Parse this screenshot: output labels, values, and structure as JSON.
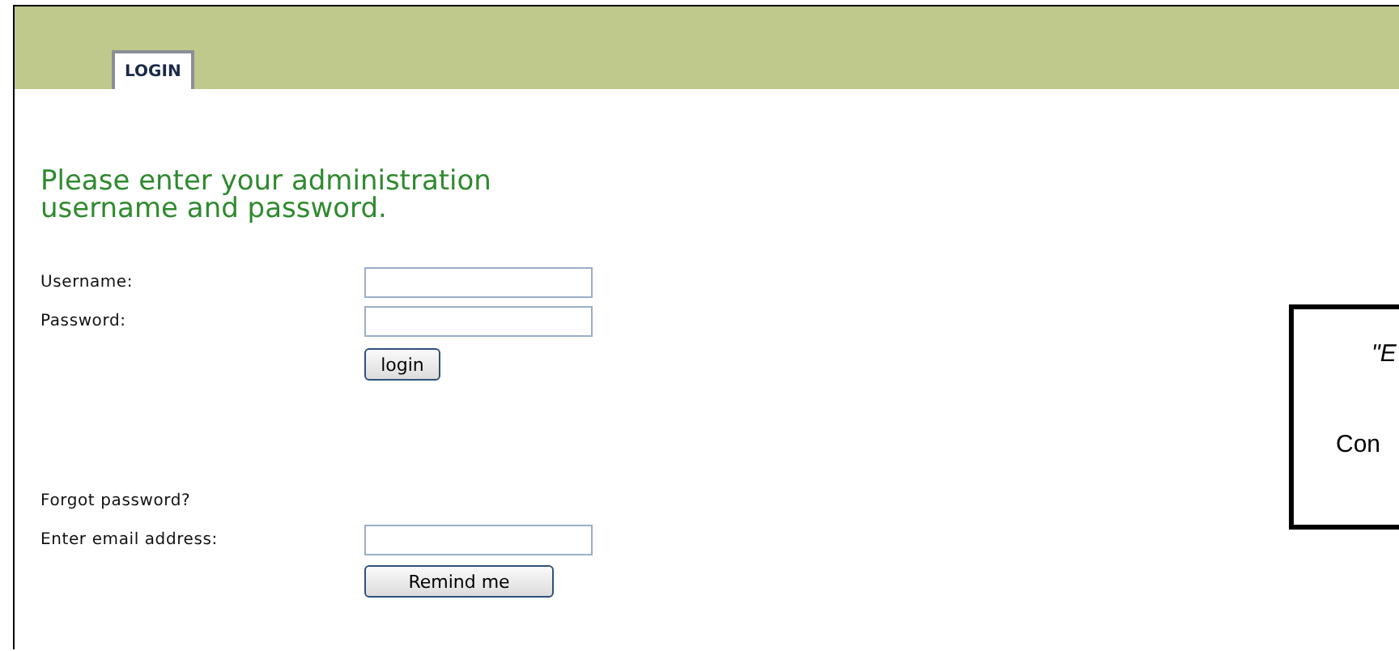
{
  "tabs": [
    {
      "label": "LOGIN",
      "selected": true
    }
  ],
  "heading": "Please enter your administration username and password.",
  "login_fields": [
    {
      "label": "Username:"
    },
    {
      "label": "Password:"
    }
  ],
  "login_button": "login",
  "forgot_title": "Forgot password?",
  "email_field": {
    "label": "Enter email address:"
  },
  "remind_button": "Remind me",
  "side_box": {
    "lines": [
      "\"E",
      "Con"
    ]
  }
}
